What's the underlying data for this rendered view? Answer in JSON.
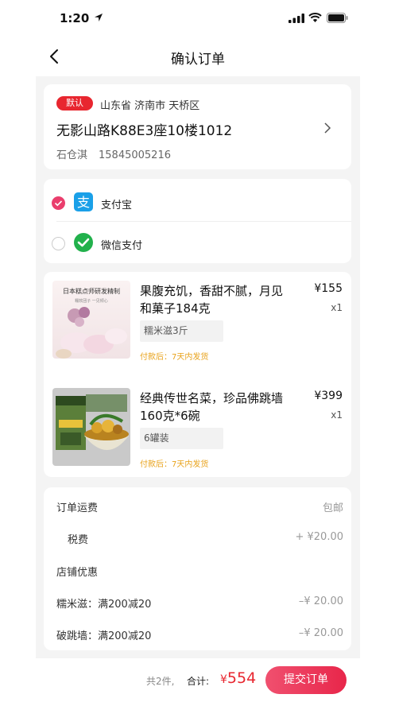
{
  "status_bar": {
    "time": "1:20"
  },
  "nav": {
    "title": "确认订单"
  },
  "address": {
    "badge": "默认",
    "region": "山东省 济南市 天桥区",
    "street": "无影山路K88E3座10楼1012",
    "name": "石仓淇",
    "phone": "15845005216"
  },
  "payment": {
    "options": [
      {
        "label": "支付宝",
        "selected": true
      },
      {
        "label": "微信支付",
        "selected": false
      }
    ]
  },
  "products": [
    {
      "name": "果腹充饥，香甜不腻，月见和菓子184克",
      "price": "¥155",
      "qty": "x1",
      "spec": "糯米滋3斤",
      "ship_note": "付款后：7天内发货",
      "thumb_text": "日本糕点师研发精制",
      "thumb_subtext": "糯软团子 一见倾心"
    },
    {
      "name": "经典传世名菜，珍品佛跳墙160克*6碗",
      "price": "¥399",
      "qty": "x1",
      "spec": "6罐装",
      "ship_note": "付款后：7天内发货"
    }
  ],
  "fees": {
    "shipping_label": "订单运费",
    "shipping_value": "包邮",
    "tax_label": "税费",
    "tax_value": "+ ¥20.00",
    "store_discount_label": "店铺优惠",
    "discounts": [
      {
        "label": "糯米滋：满200减20",
        "value": "–¥ 20.00"
      },
      {
        "label": "破跳墙：满200减20",
        "value": "–¥ 20.00"
      }
    ]
  },
  "footer": {
    "count": "共2件,",
    "total_label": "合计:",
    "currency": "¥",
    "total": "554",
    "submit_label": "提交订单"
  },
  "colors": {
    "accent": "#e8262f",
    "radio_selected": "#ea3e6d",
    "alipay": "#1aa0e8",
    "wechat": "#22b14c",
    "ship_note": "#e8a21a"
  }
}
